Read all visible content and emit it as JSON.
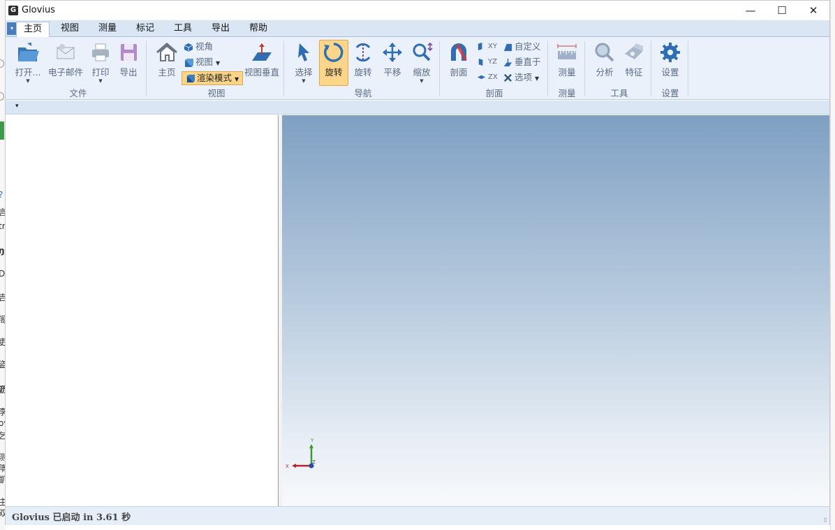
{
  "window": {
    "title": "Glovius",
    "icon_letter": "G",
    "minimize": "—",
    "maximize": "☐",
    "close": "✕"
  },
  "menu": {
    "tabs": [
      "主页",
      "视图",
      "测量",
      "标记",
      "工具",
      "导出",
      "帮助"
    ],
    "active_tab": "主页"
  },
  "ribbon": {
    "file": {
      "group_label": "文件",
      "open": "打开...",
      "email": "电子邮件",
      "print": "打印",
      "export": "导出"
    },
    "view": {
      "group_label": "视图",
      "home": "主页",
      "view_angle": "视角",
      "view": "视图",
      "render_mode": "渲染模式",
      "view_perpendicular": "视图垂直"
    },
    "navigation": {
      "group_label": "导航",
      "select": "选择",
      "rotate_active": "旋转",
      "rotate": "旋转",
      "pan": "平移",
      "zoom": "缩放"
    },
    "section": {
      "group_label": "剖面",
      "section": "剖面",
      "xy": "XY",
      "yz": "YZ",
      "zx": "ZX",
      "custom": "自定义",
      "perpendicular_to": "垂直于",
      "options": "选项"
    },
    "measure": {
      "group_label": "测量",
      "measure": "测量"
    },
    "tools": {
      "group_label": "工具",
      "analysis": "分析",
      "feature": "特征"
    },
    "settings": {
      "group_label": "设置",
      "settings": "设置"
    }
  },
  "viewport": {
    "axis_x": "X",
    "axis_y": "Y",
    "axis_z": "Z",
    "colors": {
      "x_axis": "#b0262a",
      "y_axis": "#3e9a2c",
      "z_axis": "#2a4aa8"
    }
  },
  "status": {
    "app": "Glovius",
    "started": "已启动",
    "in": "in",
    "time": "3.61",
    "unit": "秒"
  },
  "background": {
    "left_chars": [
      "言",
      "tr",
      "ŋ",
      "D",
      "吉",
      "阁",
      "吏",
      "盗",
      "沥",
      "李",
      "ov",
      "乞",
      "测",
      "隋",
      "凱",
      "主",
      "双"
    ]
  }
}
